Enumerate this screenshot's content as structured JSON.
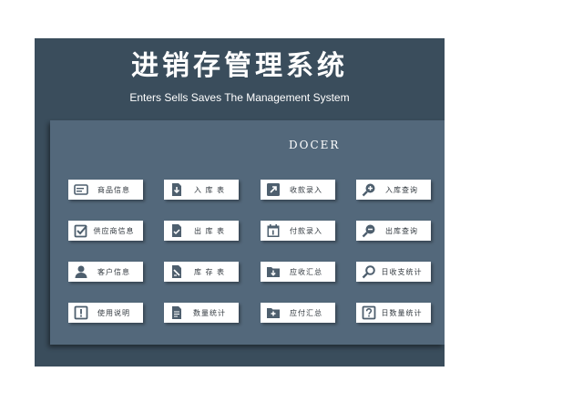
{
  "header": {
    "title": "进销存管理系统",
    "subtitle": "Enters Sells Saves The Management System",
    "brand": "DOCER"
  },
  "buttons": {
    "product_info": {
      "label": "商品信息",
      "icon": "address-card-icon"
    },
    "stock_in_table": {
      "label": "入 库 表",
      "icon": "file-download-icon"
    },
    "receipt_entry": {
      "label": "收款录入",
      "icon": "external-arrow-icon"
    },
    "stock_in_query": {
      "label": "入库查询",
      "icon": "zoom-in-icon"
    },
    "supplier_info": {
      "label": "供应商信息",
      "icon": "checkbox-icon"
    },
    "stock_out_table": {
      "label": "出 库 表",
      "icon": "file-check-icon"
    },
    "payment_entry": {
      "label": "付款录入",
      "icon": "calendar-icon"
    },
    "stock_out_query": {
      "label": "出库查询",
      "icon": "zoom-out-icon"
    },
    "customer_info": {
      "label": "客户信息",
      "icon": "user-icon"
    },
    "inventory_table": {
      "label": "库 存 表",
      "icon": "file-pen-icon"
    },
    "receivable_summary": {
      "label": "应收汇总",
      "icon": "folder-download-icon"
    },
    "daily_income_expense": {
      "label": "日收支统计",
      "icon": "search-icon"
    },
    "user_guide": {
      "label": "使用说明",
      "icon": "exclamation-icon"
    },
    "quantity_stats": {
      "label": "数量统计",
      "icon": "document-icon"
    },
    "payable_summary": {
      "label": "应付汇总",
      "icon": "folder-plus-icon"
    },
    "daily_quantity_stats": {
      "label": "日数量统计",
      "icon": "question-icon"
    }
  },
  "colors": {
    "background": "#3a4d5c",
    "panel": "#53687b",
    "icon": "#4e5f6e",
    "button": "#ffffff"
  }
}
